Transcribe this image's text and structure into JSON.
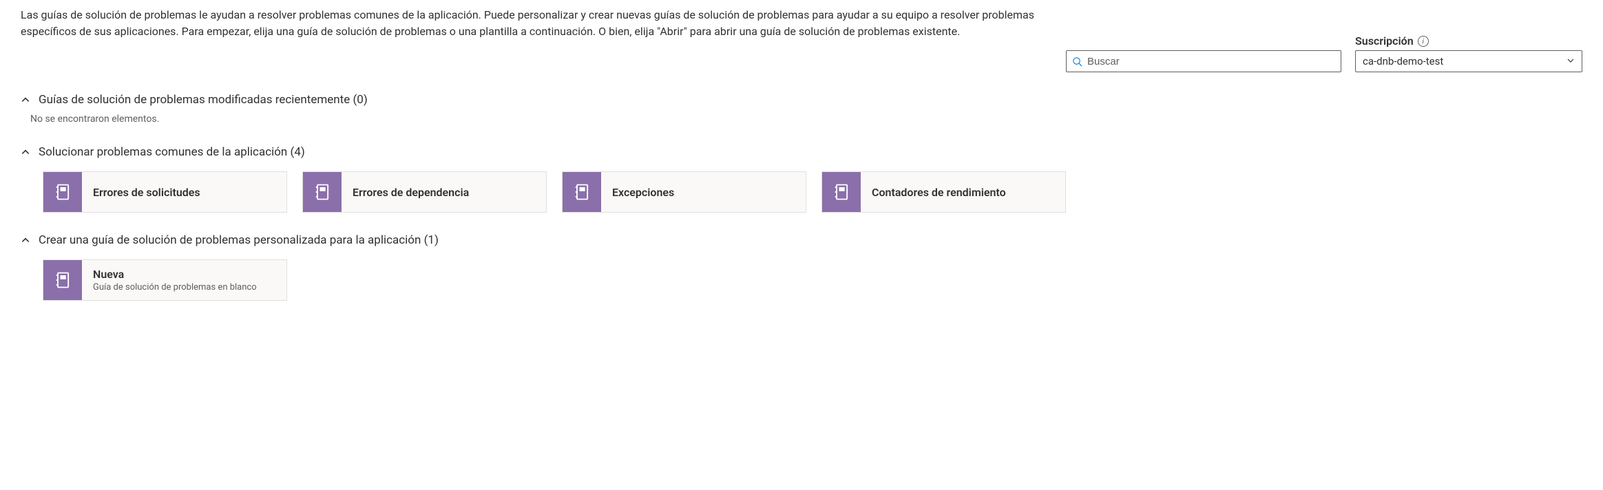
{
  "intro": "Las guías de solución de problemas le ayudan a resolver problemas comunes de la aplicación. Puede personalizar y crear nuevas guías de solución de problemas para ayudar a su equipo a resolver problemas específicos de sus aplicaciones. Para empezar, elija una guía de solución de problemas o una plantilla a continuación. O bien, elija \"Abrir\" para abrir una guía de solución de problemas existente.",
  "search": {
    "placeholder": "Buscar"
  },
  "subscription": {
    "label": "Suscripción",
    "selected": "ca-dnb-demo-test"
  },
  "sections": {
    "recent": {
      "title": "Guías de solución de problemas modificadas recientemente (0)",
      "empty": "No se encontraron elementos."
    },
    "common": {
      "title": "Solucionar problemas comunes de la aplicación (4)",
      "cards": [
        {
          "title": "Errores de solicitudes"
        },
        {
          "title": "Errores de dependencia"
        },
        {
          "title": "Excepciones"
        },
        {
          "title": "Contadores de rendimiento"
        }
      ]
    },
    "custom": {
      "title": "Crear una guía de solución de problemas personalizada para la aplicación (1)",
      "cards": [
        {
          "title": "Nueva",
          "subtitle": "Guía de solución de problemas en blanco"
        }
      ]
    }
  },
  "colors": {
    "accent": "#0078d4",
    "card_icon_bg": "#8a6faa"
  }
}
